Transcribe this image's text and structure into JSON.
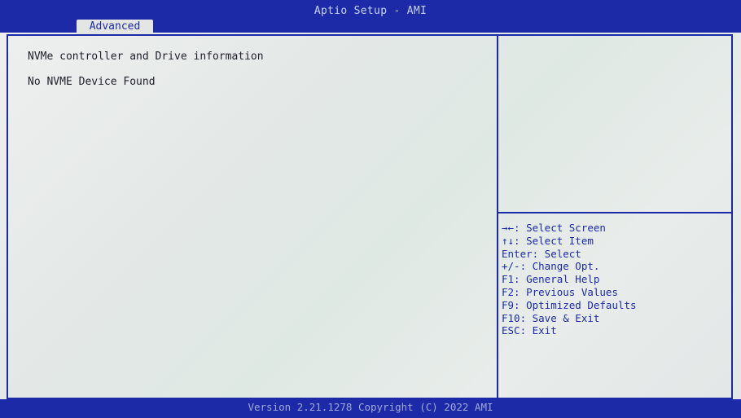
{
  "header": {
    "title": "Aptio Setup - AMI",
    "tabs": [
      {
        "label": "Advanced",
        "active": true
      }
    ]
  },
  "main": {
    "lines": [
      "NVMe controller and Drive information",
      "No NVME Device Found"
    ]
  },
  "help_panel": {
    "description": "",
    "keys": [
      "→←: Select Screen",
      "↑↓: Select Item",
      "Enter: Select",
      "+/-: Change Opt.",
      "F1: General Help",
      "F2: Previous Values",
      "F9: Optimized Defaults",
      "F10: Save & Exit",
      "ESC: Exit"
    ]
  },
  "footer": {
    "version": "Version 2.21.1278 Copyright (C) 2022 AMI"
  },
  "colors": {
    "bios_blue": "#1c2aa8",
    "text_dark": "#1e1e2a",
    "background": "#e9ecec"
  }
}
